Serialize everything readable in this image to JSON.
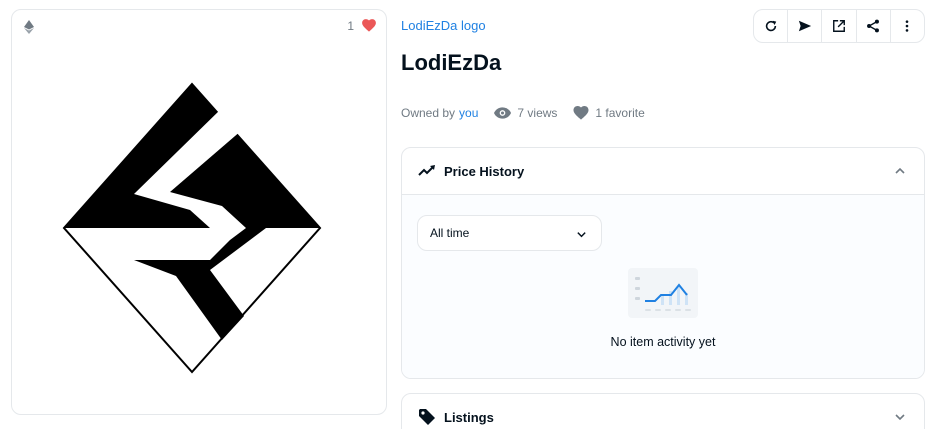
{
  "asset": {
    "favorite_count": "1",
    "collection_link": "LodiEzDa logo",
    "title": "LodiEzDa"
  },
  "toolbar": {
    "buttons": [
      "refresh-icon",
      "send-icon",
      "external-link-icon",
      "share-icon",
      "more-icon"
    ]
  },
  "meta": {
    "owned_by_label": "Owned by",
    "owner": "you",
    "views": "7 views",
    "favorites": "1 favorite"
  },
  "price_history": {
    "title": "Price History",
    "filter_selected": "All time",
    "empty_text": "No item activity yet"
  },
  "listings": {
    "title": "Listings"
  },
  "colors": {
    "accent": "#2081e2",
    "heart": "#eb5757",
    "border": "#e5e8eb",
    "muted": "#707a83"
  }
}
